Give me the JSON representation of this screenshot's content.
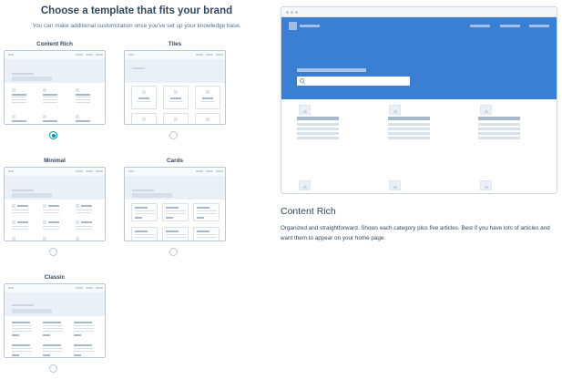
{
  "header": {
    "title": "Choose a template that fits your brand",
    "subtitle": "You can make additional customization once you've set up your knowledge base."
  },
  "templates": [
    {
      "label": "Content Rich",
      "selected": true
    },
    {
      "label": "Tiles",
      "selected": false
    },
    {
      "label": "Minimal",
      "selected": false
    },
    {
      "label": "Cards",
      "selected": false
    },
    {
      "label": "Classic",
      "selected": false
    }
  ],
  "preview": {
    "name": "Content Rich",
    "description": "Organized and straightforward. Shows each category plus five articles. Best if you have lots of articles and want them to appear on your home page.",
    "hero_color": "#3b7fd4"
  },
  "colors": {
    "accent": "#0091ae",
    "text": "#33475b",
    "border": "#cbd6e2"
  },
  "icons": [
    "search-icon",
    "image-placeholder-icon"
  ]
}
